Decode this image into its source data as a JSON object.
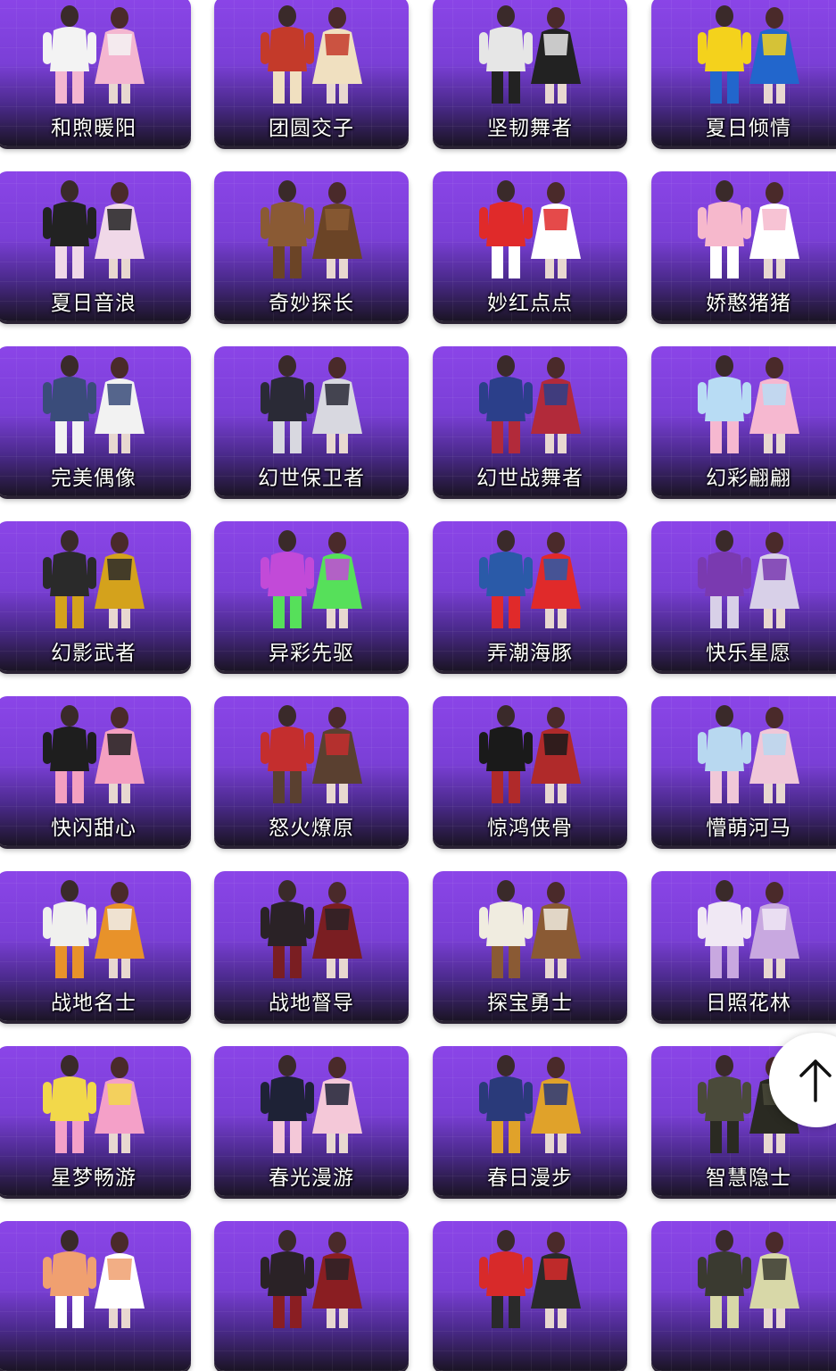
{
  "outfits": [
    {
      "label": "和煦暖阳",
      "colors": [
        "#f3f3f3",
        "#f4b6d0"
      ]
    },
    {
      "label": "团圆交子",
      "colors": [
        "#c43a2a",
        "#f0e0c0"
      ]
    },
    {
      "label": "坚韧舞者",
      "colors": [
        "#e6e6e6",
        "#222222"
      ]
    },
    {
      "label": "夏日倾情",
      "colors": [
        "#f4d21c",
        "#2266cc"
      ]
    },
    {
      "label": "夏日音浪",
      "colors": [
        "#222222",
        "#f0d8e8"
      ]
    },
    {
      "label": "奇妙探长",
      "colors": [
        "#8a5a34",
        "#6b4426"
      ]
    },
    {
      "label": "妙红点点",
      "colors": [
        "#e02a2a",
        "#ffffff"
      ]
    },
    {
      "label": "娇憨猪猪",
      "colors": [
        "#f6b8cc",
        "#ffffff"
      ]
    },
    {
      "label": "完美偶像",
      "colors": [
        "#3a4c7a",
        "#f2f2f2"
      ]
    },
    {
      "label": "幻世保卫者",
      "colors": [
        "#2a2a36",
        "#d8d8e0"
      ]
    },
    {
      "label": "幻世战舞者",
      "colors": [
        "#2b3f8a",
        "#b22a3a"
      ]
    },
    {
      "label": "幻彩翩翩",
      "colors": [
        "#b8dcf4",
        "#f6b8d0"
      ]
    },
    {
      "label": "幻影武者",
      "colors": [
        "#2a2a2a",
        "#d4a21c"
      ]
    },
    {
      "label": "异彩先驱",
      "colors": [
        "#c24ad8",
        "#56e05a"
      ]
    },
    {
      "label": "弄潮海豚",
      "colors": [
        "#2a5aa8",
        "#e02a2a"
      ]
    },
    {
      "label": "快乐星愿",
      "colors": [
        "#7a3ab0",
        "#d8d0e8"
      ]
    },
    {
      "label": "快闪甜心",
      "colors": [
        "#1e1e1e",
        "#f4a0c0"
      ]
    },
    {
      "label": "怒火燎原",
      "colors": [
        "#c42e2e",
        "#5a4030"
      ]
    },
    {
      "label": "惊鸿侠骨",
      "colors": [
        "#1a1a1a",
        "#b02a2a"
      ]
    },
    {
      "label": "懵萌河马",
      "colors": [
        "#b8d8f0",
        "#f0c8d8"
      ]
    },
    {
      "label": "战地名士",
      "colors": [
        "#f0f0ee",
        "#e8922a"
      ]
    },
    {
      "label": "战地督导",
      "colors": [
        "#2a2226",
        "#7a1e22"
      ]
    },
    {
      "label": "探宝勇士",
      "colors": [
        "#f0ece0",
        "#8a5a34"
      ]
    },
    {
      "label": "日照花林",
      "colors": [
        "#f0e8f4",
        "#c8a8e0"
      ]
    },
    {
      "label": "星梦畅游",
      "colors": [
        "#f2d84a",
        "#f4a0c8"
      ]
    },
    {
      "label": "春光漫游",
      "colors": [
        "#1e2236",
        "#f4c8d8"
      ]
    },
    {
      "label": "春日漫步",
      "colors": [
        "#2a3a7a",
        "#e0a22a"
      ]
    },
    {
      "label": "智慧隐士",
      "colors": [
        "#4a4a3a",
        "#2a2a22"
      ]
    },
    {
      "label": "",
      "colors": [
        "#f0a070",
        "#ffffff"
      ]
    },
    {
      "label": "",
      "colors": [
        "#2a2226",
        "#8a1e22"
      ]
    },
    {
      "label": "",
      "colors": [
        "#d82a2a",
        "#2a2a2a"
      ]
    },
    {
      "label": "",
      "colors": [
        "#3a3a30",
        "#d8d8a8"
      ]
    }
  ],
  "back_to_top": {
    "icon": "arrow-up-icon"
  }
}
